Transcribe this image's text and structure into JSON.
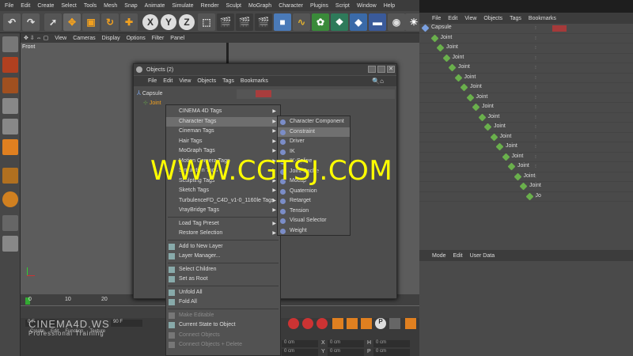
{
  "menubar": [
    "File",
    "Edit",
    "Create",
    "Select",
    "Tools",
    "Mesh",
    "Snap",
    "Animate",
    "Simulate",
    "Render",
    "Sculpt",
    "MoGraph",
    "Character",
    "Plugins",
    "Script",
    "Window",
    "Help"
  ],
  "viewport_menu": [
    "View",
    "Cameras",
    "Display",
    "Options",
    "Filter",
    "Panel"
  ],
  "viewport_label": "Front",
  "toolbar_axes": [
    "X",
    "Y",
    "Z"
  ],
  "objects_panel": {
    "menu": [
      "File",
      "Edit",
      "View",
      "Objects",
      "Tags",
      "Bookmarks"
    ],
    "tree": [
      "Capsule",
      "Joint",
      "Joint",
      "Joint",
      "Joint",
      "Joint",
      "Joint",
      "Joint",
      "Joint",
      "Joint",
      "Joint",
      "Joint",
      "Joint",
      "Joint",
      "Joint",
      "Joint",
      "Joint",
      "Jo"
    ]
  },
  "attributes_menu": [
    "Mode",
    "Edit",
    "User Data"
  ],
  "dialog": {
    "title": "Objects (2)",
    "menu": [
      "File",
      "Edit",
      "View",
      "Objects",
      "Tags",
      "Bookmarks"
    ],
    "tree": [
      "Capsule",
      "Joint"
    ]
  },
  "context_menu": {
    "group1": [
      "CINEMA 4D Tags",
      "Character Tags",
      "Cineman Tags",
      "Hair Tags",
      "MoGraph Tags",
      "Motion Camera Tags",
      "Simulation Tags",
      "Sculpting Tags",
      "Sketch Tags",
      "TurbulenceFD_C4D_v1-0_1160le Tags",
      "VrayBridge Tags"
    ],
    "group2": [
      "Load Tag Preset",
      "Restore Selection"
    ],
    "group3": [
      "Add to New Layer",
      "Layer Manager..."
    ],
    "group4": [
      "Select Children",
      "Set as Root"
    ],
    "group5": [
      "Unfold All",
      "Fold All"
    ],
    "group6": [
      "Make Editable",
      "Current State to Object",
      "Connect Objects",
      "Connect Objects + Delete"
    ],
    "highlighted": "Character Tags"
  },
  "submenu": {
    "items": [
      "Character Component",
      "Constraint",
      "Driver",
      "IK",
      "IK-Spline",
      "Joint Cache",
      "Mocap",
      "Quaternion",
      "Retarget",
      "Tension",
      "Visual Selector",
      "Weight"
    ],
    "highlighted": "Constraint"
  },
  "timeline": {
    "ticks": [
      "0",
      "10",
      "20"
    ],
    "start": "0 F",
    "end": "90 F",
    "current": "0 F"
  },
  "coords": [
    "0 cm",
    "0 cm",
    "0 cm",
    "0 cm",
    "0 cm",
    "0 cm"
  ],
  "coord_labels": [
    "X",
    "H",
    "Y",
    "P"
  ],
  "bottom_menu": [
    "Create",
    "Edit",
    "Function",
    "Texture"
  ],
  "logo": {
    "line1": "CINEMA4D.WS",
    "line2": "Professional Training"
  },
  "watermark": "WWW.CGTSJ.COM"
}
